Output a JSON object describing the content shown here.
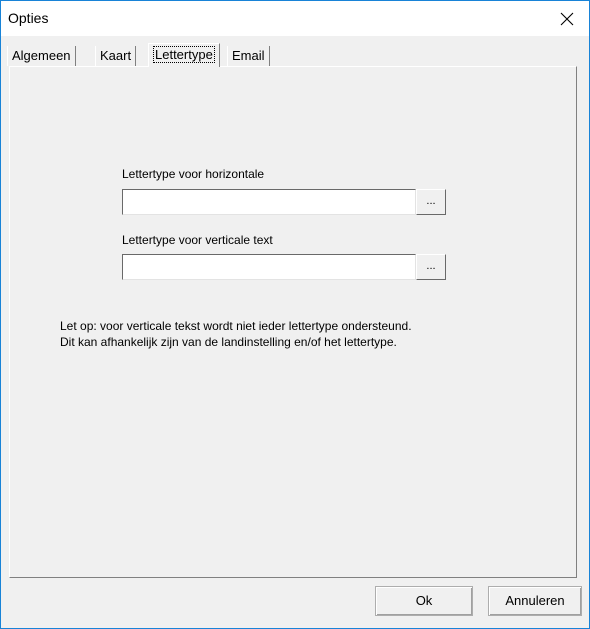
{
  "window": {
    "title": "Opties"
  },
  "tabs": [
    {
      "label": "Algemeen",
      "active": false
    },
    {
      "label": "Kaart",
      "active": false
    },
    {
      "label": "Lettertype",
      "active": true
    },
    {
      "label": "Email",
      "active": false
    }
  ],
  "font": {
    "horizontal_label": "Lettertype voor horizontale",
    "horizontal_value": "",
    "vertical_label": "Lettertype voor verticale text",
    "vertical_value": "",
    "browse_label": "..."
  },
  "note": {
    "line1": "Let op: voor verticale tekst wordt niet ieder lettertype ondersteund.",
    "line2": "Dit kan afhankelijk zijn van de landinstelling en/of het lettertype."
  },
  "buttons": {
    "ok": "Ok",
    "cancel": "Annuleren"
  }
}
